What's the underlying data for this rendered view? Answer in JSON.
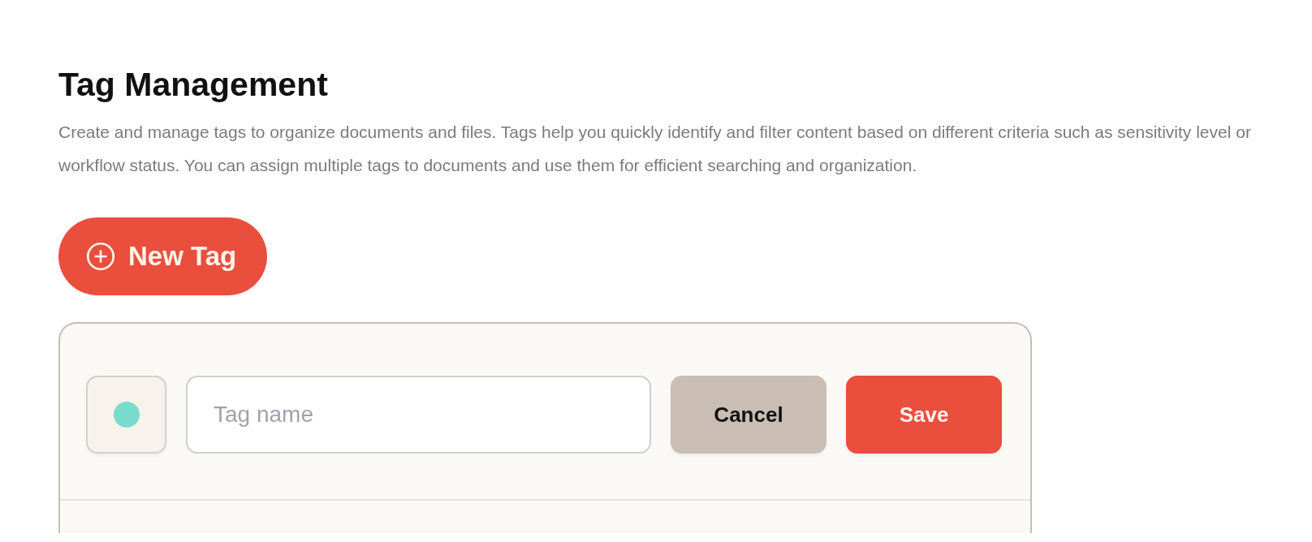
{
  "page": {
    "title": "Tag Management",
    "description": "Create and manage tags to organize documents and files. Tags help you quickly identify and filter content based on different criteria such as sensitivity level or workflow status. You can assign multiple tags to documents and use them for efficient searching and organization."
  },
  "new_tag_button": {
    "label": "New Tag"
  },
  "tag_form": {
    "color": "#77dccb",
    "name_field": {
      "placeholder": "Tag name"
    },
    "buttons": [
      {
        "kind": "secondary",
        "label": "Cancel"
      },
      {
        "kind": "primary",
        "label": "Save"
      }
    ]
  }
}
